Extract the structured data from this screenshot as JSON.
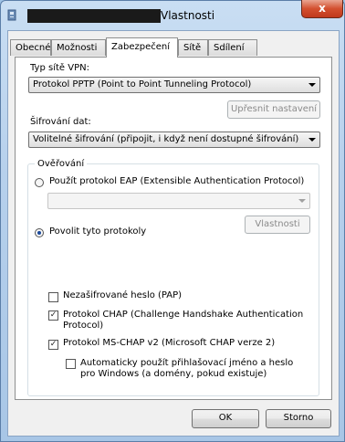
{
  "window": {
    "title": "Vlastnosti",
    "close": "x"
  },
  "tabs": [
    {
      "label": "Obecné"
    },
    {
      "label": "Možnosti"
    },
    {
      "label": "Zabezpečení"
    },
    {
      "label": "Sítě"
    },
    {
      "label": "Sdílení"
    }
  ],
  "vpn": {
    "type_label": "Typ sítě VPN:",
    "type_value": "Protokol PPTP (Point to Point Tunneling Protocol)",
    "advanced_button": "Upřesnit nastavení"
  },
  "encryption": {
    "label": "Šifrování dat:",
    "value": "Volitelné šifrování (připojit, i když není dostupné šifrování)"
  },
  "auth": {
    "legend": "Ověřování",
    "eap_radio": "Použít protokol EAP (Extensible Authentication Protocol)",
    "eap_combo": "",
    "properties_button": "Vlastnosti",
    "allow_radio": "Povolit tyto protokoly",
    "pap": {
      "label": "Nezašifrované heslo (PAP)",
      "checked": false
    },
    "chap": {
      "label": "Protokol CHAP (Challenge Handshake Authentication Protocol)",
      "checked": true
    },
    "mschap": {
      "label": "Protokol MS-CHAP v2 (Microsoft CHAP verze 2)",
      "checked": true
    },
    "auto_logon": {
      "label": "Automaticky použít přihlašovací jméno a heslo pro Windows (a domény, pokud existuje)",
      "checked": false
    }
  },
  "footer": {
    "ok": "OK",
    "cancel": "Storno"
  },
  "colors": {
    "titlebar": "#b6d0ec",
    "close": "#c0391c",
    "radio_dot": "#1b4a9b"
  }
}
